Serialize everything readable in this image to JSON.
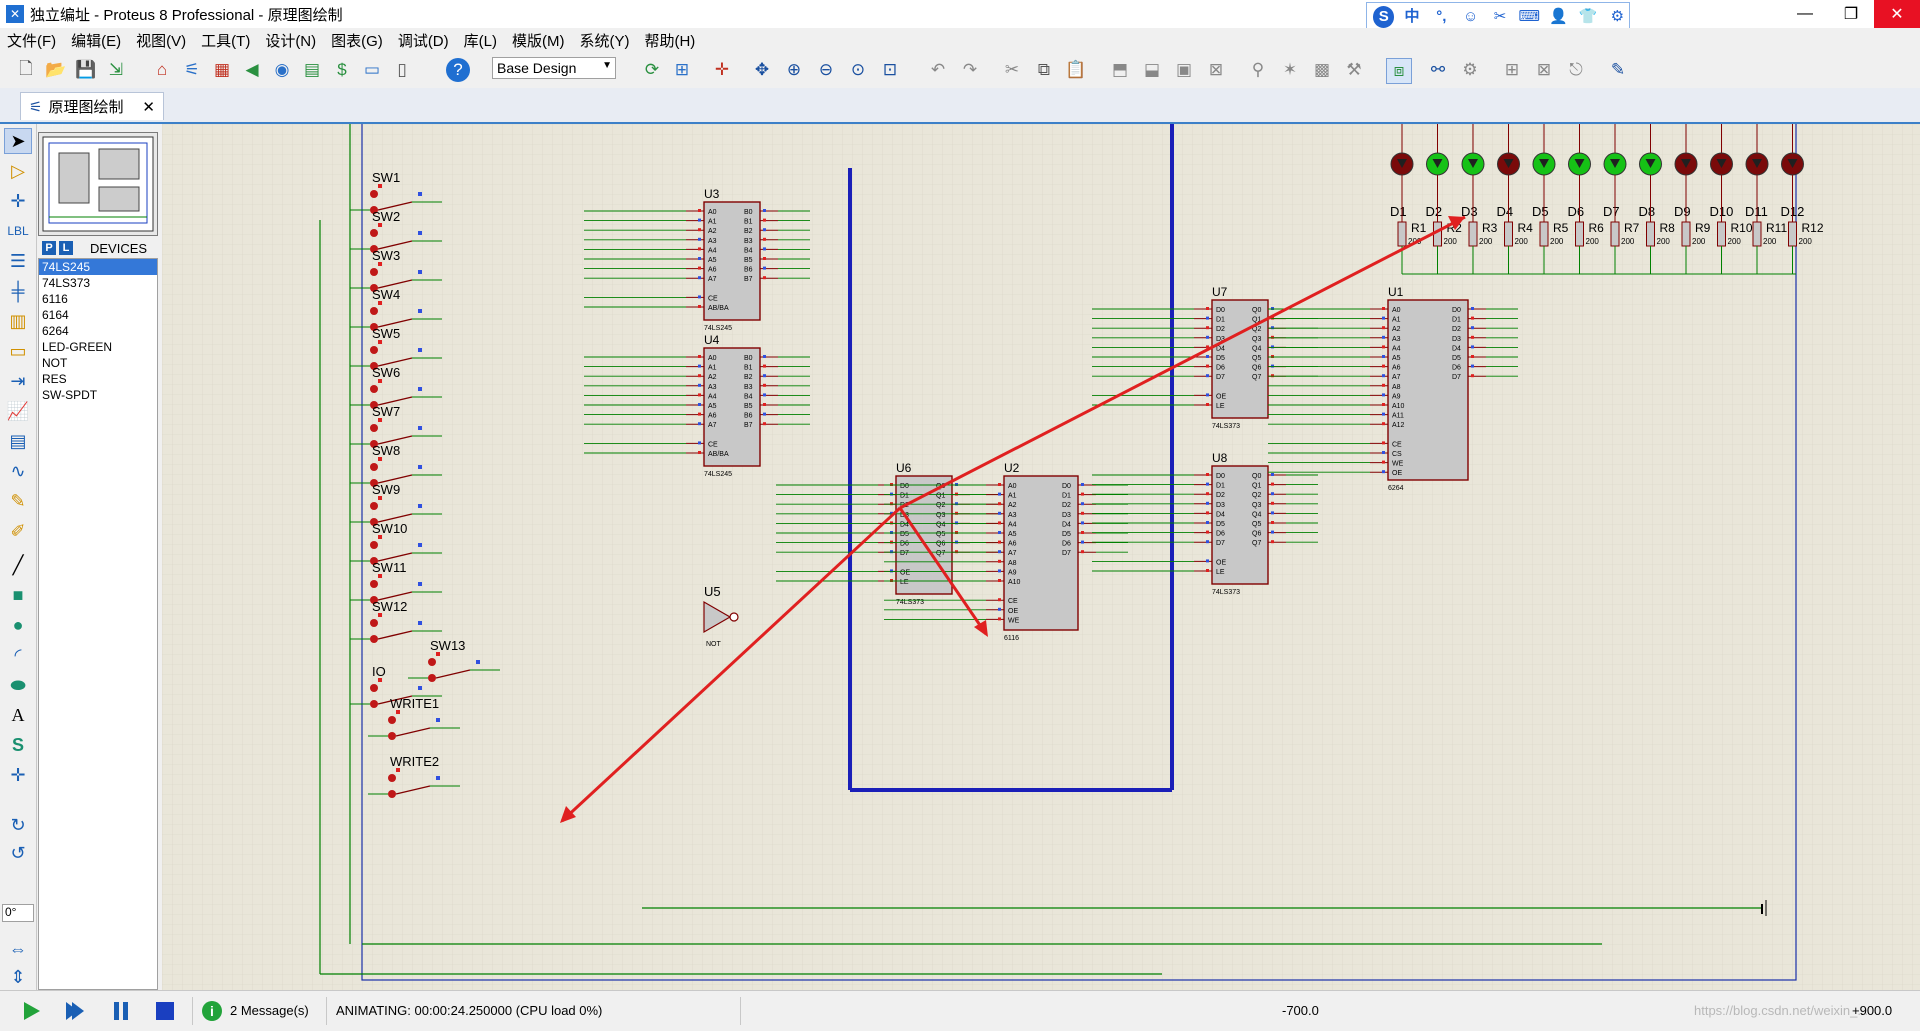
{
  "window": {
    "title": "独立编址 - Proteus 8 Professional - 原理图绘制",
    "controls": [
      "minimize-icon",
      "maximize-icon",
      "close-icon"
    ]
  },
  "menu": [
    "文件(F)",
    "编辑(E)",
    "视图(V)",
    "工具(T)",
    "设计(N)",
    "图表(G)",
    "调试(D)",
    "库(L)",
    "模版(M)",
    "系统(Y)",
    "帮助(H)"
  ],
  "toolbar": {
    "design_select": "Base Design"
  },
  "tab": {
    "label": "原理图绘制"
  },
  "devices": {
    "pick_button": "P",
    "lib_button": "L",
    "title": "DEVICES",
    "items": [
      "74LS245",
      "74LS373",
      "6116",
      "6164",
      "6264",
      "LED-GREEN",
      "NOT",
      "RES",
      "SW-SPDT"
    ],
    "selected": "74LS245"
  },
  "rotation": "0°",
  "schematic": {
    "switches": [
      "SW1",
      "SW2",
      "SW3",
      "SW4",
      "SW5",
      "SW6",
      "SW7",
      "SW8",
      "SW9",
      "SW10",
      "SW11",
      "SW12",
      "SW13",
      "IO",
      "WRITE1",
      "WRITE2"
    ],
    "chips": [
      {
        "ref": "U3",
        "part": "74LS245"
      },
      {
        "ref": "U4",
        "part": "74LS245"
      },
      {
        "ref": "U5",
        "part": "NOT"
      },
      {
        "ref": "U6",
        "part": "74LS373"
      },
      {
        "ref": "U2",
        "part": "6116"
      },
      {
        "ref": "U7",
        "part": "74LS373"
      },
      {
        "ref": "U8",
        "part": "74LS373"
      },
      {
        "ref": "U1",
        "part": "6264"
      }
    ],
    "leds": [
      "D1",
      "D2",
      "D3",
      "D4",
      "D5",
      "D6",
      "D7",
      "D8",
      "D9",
      "D10",
      "D11",
      "D12"
    ],
    "resistors": [
      "R1",
      "R2",
      "R3",
      "R4",
      "R5",
      "R6",
      "R7",
      "R8",
      "R9",
      "R10",
      "R11",
      "R12"
    ],
    "resistor_value": "200"
  },
  "status": {
    "messages": "2 Message(s)",
    "animating": "ANIMATING: 00:00:24.250000 (CPU load 0%)",
    "coord_x": "-700.0",
    "coord_y": "+900.0",
    "watermark": "https://blog.csdn.net/weixin_..."
  }
}
